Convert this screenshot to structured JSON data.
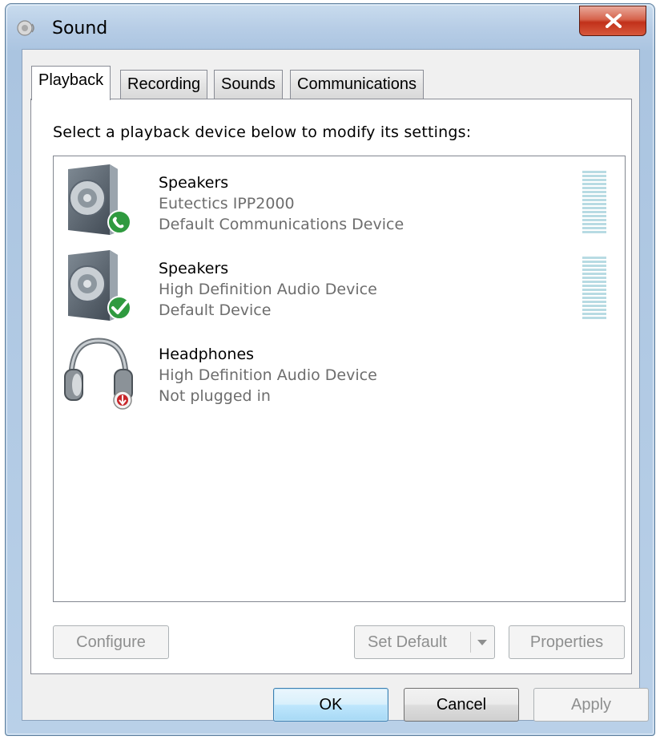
{
  "window": {
    "title": "Sound",
    "close_label": "X"
  },
  "tabs": [
    {
      "label": "Playback",
      "active": true
    },
    {
      "label": "Recording",
      "active": false
    },
    {
      "label": "Sounds",
      "active": false
    },
    {
      "label": "Communications",
      "active": false
    }
  ],
  "playback": {
    "instruction": "Select a playback device below to modify its settings:",
    "devices": [
      {
        "name": "Speakers",
        "line2": "Eutectics IPP2000",
        "line3": "Default Communications Device",
        "icon": "speaker-icon",
        "badge": "phone-badge-icon",
        "meter_level": 0
      },
      {
        "name": "Speakers",
        "line2": "High Definition Audio Device",
        "line3": "Default Device",
        "icon": "speaker-icon",
        "badge": "checkmark-badge-icon",
        "meter_level": 0
      },
      {
        "name": "Headphones",
        "line2": "High Definition Audio Device",
        "line3": "Not plugged in",
        "icon": "headphones-icon",
        "badge": "unplugged-badge-icon"
      }
    ],
    "buttons": {
      "configure": "Configure",
      "set_default": "Set Default",
      "properties": "Properties"
    }
  },
  "dialog_buttons": {
    "ok": "OK",
    "cancel": "Cancel",
    "apply": "Apply"
  },
  "colors": {
    "default_button_border": "#3c7fb1",
    "disabled_text": "#8e8f8f",
    "secondary_text": "#6d6d6d",
    "meter": "#b8dbe3",
    "close_button": "#c1311a"
  }
}
